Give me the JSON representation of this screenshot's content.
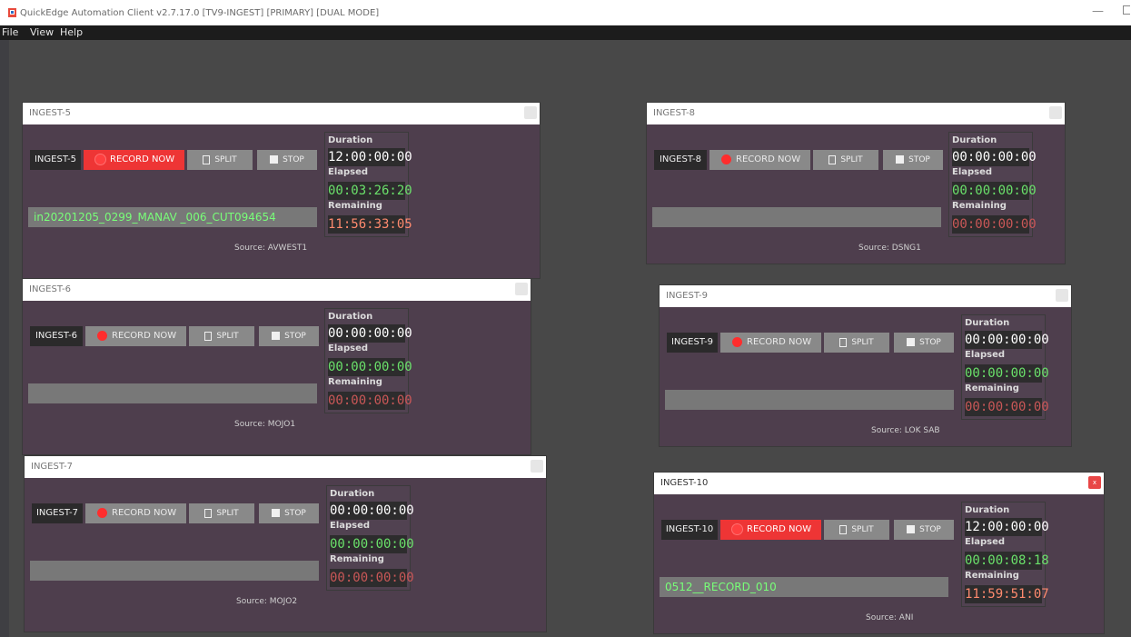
{
  "app": {
    "title": "QuickEdge Automation Client v2.7.17.0 [TV9-INGEST] [PRIMARY] [DUAL MODE]",
    "minimize_glyph": "—"
  },
  "menu": [
    "File",
    "View",
    "Help"
  ],
  "labels": {
    "record": "RECORD NOW",
    "split": "SPLIT",
    "stop": "STOP",
    "duration": "Duration",
    "elapsed": "Elapsed",
    "remaining": "Remaining",
    "close_glyph": "x"
  },
  "colors": {
    "record_active": "#ee3535",
    "elapsed": "#6ae06a",
    "remaining": "#c95757",
    "filename": "#78ff78"
  },
  "panels": [
    {
      "title": "INGEST-5",
      "channel": "INGEST-5",
      "recording": true,
      "filename": "in20201205_0299_MANAV _006_CUT094654",
      "source": "Source: AVWEST1",
      "duration": "12:00:00:00",
      "elapsed": "00:03:26:20",
      "remaining": "11:56:33:05"
    },
    {
      "title": "INGEST-6",
      "channel": "INGEST-6",
      "recording": false,
      "filename": "",
      "source": "Source: MOJO1",
      "duration": "00:00:00:00",
      "elapsed": "00:00:00:00",
      "remaining": "00:00:00:00"
    },
    {
      "title": "INGEST-7",
      "channel": "INGEST-7",
      "recording": false,
      "filename": "",
      "source": "Source: MOJO2",
      "duration": "00:00:00:00",
      "elapsed": "00:00:00:00",
      "remaining": "00:00:00:00"
    },
    {
      "title": "INGEST-8",
      "channel": "INGEST-8",
      "recording": false,
      "filename": "",
      "source": "Source: DSNG1",
      "duration": "00:00:00:00",
      "elapsed": "00:00:00:00",
      "remaining": "00:00:00:00"
    },
    {
      "title": "INGEST-9",
      "channel": "INGEST-9",
      "recording": false,
      "filename": "",
      "source": "Source: LOK SAB",
      "duration": "00:00:00:00",
      "elapsed": "00:00:00:00",
      "remaining": "00:00:00:00"
    },
    {
      "title": "INGEST-10",
      "channel": "INGEST-10",
      "recording": true,
      "active": true,
      "filename": "0512__RECORD_010",
      "source": "Source: ANI",
      "duration": "12:00:00:00",
      "elapsed": "00:00:08:18",
      "remaining": "11:59:51:07"
    }
  ]
}
